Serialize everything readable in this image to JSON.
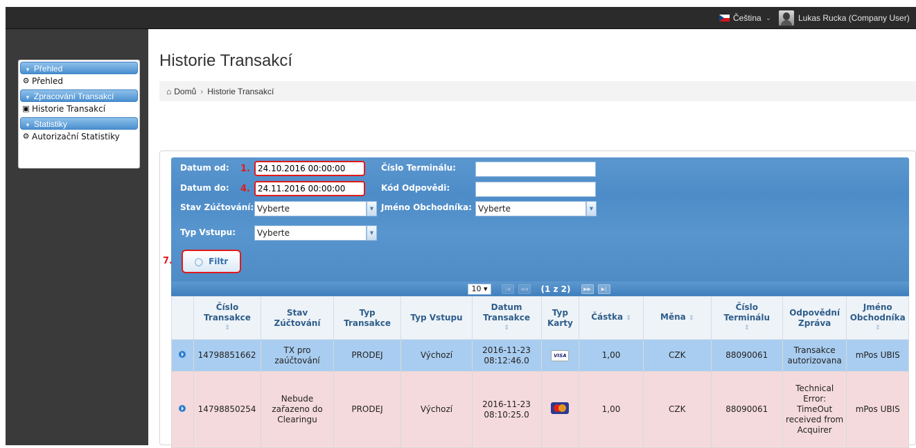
{
  "topbar": {
    "language": "Čeština",
    "user": "Lukas Rucka (Company User)"
  },
  "sidebar": {
    "sections": [
      {
        "title": "Přehled",
        "items": [
          {
            "label": "Přehled",
            "icon": "dashboard-icon"
          }
        ]
      },
      {
        "title": "Zpracování Transakcí",
        "items": [
          {
            "label": "Historie Transakcí",
            "icon": "document-icon"
          }
        ]
      },
      {
        "title": "Statistiky",
        "items": [
          {
            "label": "Autorizační Statistiky",
            "icon": "dashboard-icon"
          }
        ]
      }
    ]
  },
  "page": {
    "title": "Historie Transakcí",
    "breadcrumb": {
      "home": "Domů",
      "current": "Historie Transakcí"
    }
  },
  "filter": {
    "date_from_label": "Datum od:",
    "date_from_value": "24.10.2016 00:00:00",
    "date_to_label": "Datum do:",
    "date_to_value": "24.11.2016 00:00:00",
    "terminal_label": "Číslo Terminálu:",
    "terminal_value": "",
    "response_code_label": "Kód Odpovědi:",
    "response_code_value": "",
    "settlement_label": "Stav Zúčtování:",
    "settlement_value": "Vyberte",
    "merchant_label": "Jméno Obchodníka:",
    "merchant_value": "Vyberte",
    "input_type_label": "Typ Vstupu:",
    "input_type_value": "Vyberte",
    "button_label": "Filtr",
    "annotations": {
      "a1": "1.",
      "a4": "4.",
      "a7": "7."
    }
  },
  "pager": {
    "page_size": "10",
    "status": "(1 z 2)"
  },
  "table": {
    "headers": {
      "transaction_no": "Číslo Transakce",
      "settlement": "Stav Zúčtování",
      "tx_type": "Typ Transakce",
      "input_type": "Typ Vstupu",
      "tx_date": "Datum Transakce",
      "card_type": "Typ Karty",
      "amount": "Částka",
      "currency": "Měna",
      "terminal": "Číslo Terminálu",
      "response": "Odpovědní Zpráva",
      "merchant": "Jméno Obchodníka"
    },
    "rows": [
      {
        "transaction_no": "14798851662",
        "settlement": "TX pro zaúčtování",
        "tx_type": "PRODEJ",
        "input_type": "Výchozí",
        "tx_date": "2016-11-23 08:12:46.0",
        "card": "VISA",
        "amount": "1,00",
        "currency": "CZK",
        "terminal": "88090061",
        "response": "Transakce autorizovana",
        "merchant": "mPos UBIS"
      },
      {
        "transaction_no": "14798850254",
        "settlement": "Nebude zařazeno do Clearingu",
        "tx_type": "PRODEJ",
        "input_type": "Výchozí",
        "tx_date": "2016-11-23 08:10:25.0",
        "card": "mastercard-icon",
        "amount": "1,00",
        "currency": "CZK",
        "terminal": "88090061",
        "response": "Technical Error: TimeOut received from Acquirer",
        "merchant": "mPos UBIS"
      }
    ]
  },
  "colors": {
    "accent_blue": "#4d8cc8",
    "annotation_red": "#e01a1a",
    "row_selected": "#a9cdf0",
    "row_error": "#f5dadd"
  }
}
